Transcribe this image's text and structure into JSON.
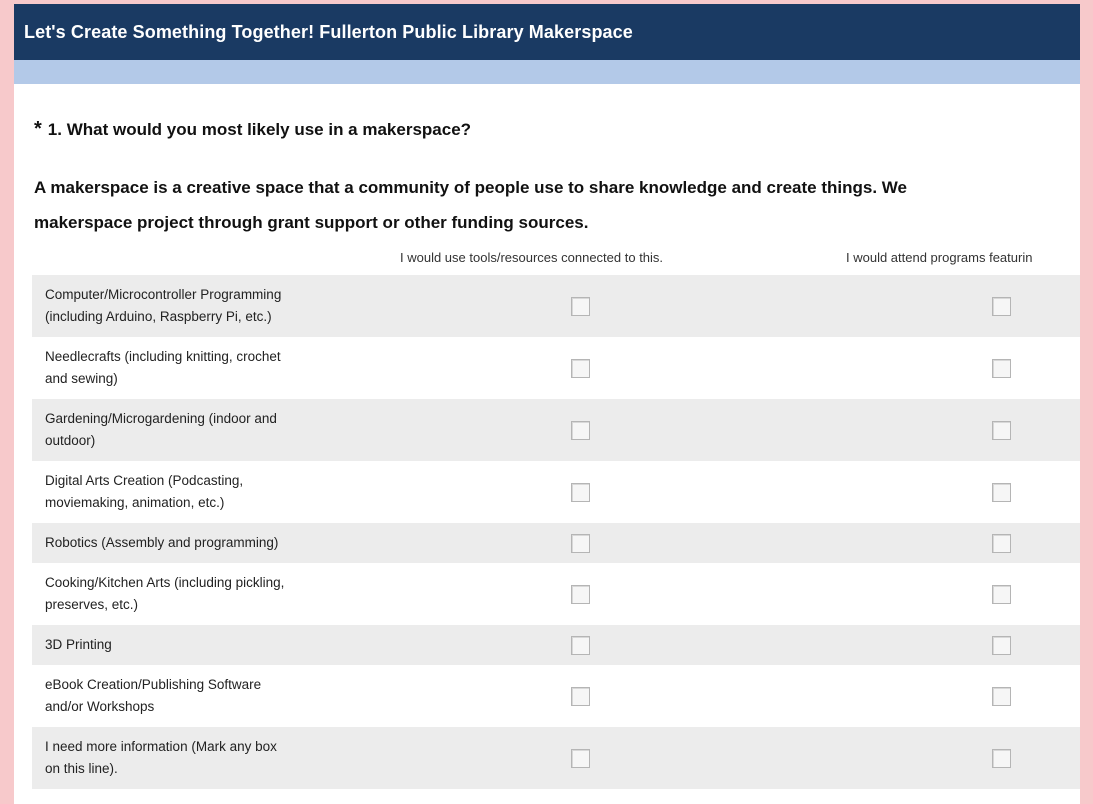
{
  "survey": {
    "title": "Let's Create Something Together! Fullerton Public Library Makerspace",
    "question": {
      "required_marker": "*",
      "text": "1. What would you most likely use in a makerspace?"
    },
    "description_lines": [
      "A makerspace is a creative space that a community of people use to share knowledge and create things. We",
      "makerspace project through grant support or other funding sources."
    ],
    "columns": [
      "I would use tools/resources connected to this.",
      "I would attend programs featurin"
    ],
    "rows": [
      {
        "label_lines": [
          "Computer/Microcontroller Programming",
          "(including Arduino, Raspberry Pi, etc.)"
        ],
        "use": false,
        "attend": false
      },
      {
        "label_lines": [
          "Needlecrafts (including knitting, crochet",
          "and sewing)"
        ],
        "use": false,
        "attend": false
      },
      {
        "label_lines": [
          "Gardening/Microgardening (indoor and",
          "outdoor)"
        ],
        "use": false,
        "attend": false
      },
      {
        "label_lines": [
          "Digital Arts Creation (Podcasting,",
          "moviemaking, animation, etc.)"
        ],
        "use": false,
        "attend": false
      },
      {
        "label_lines": [
          "Robotics (Assembly and programming)"
        ],
        "use": false,
        "attend": false
      },
      {
        "label_lines": [
          "Cooking/Kitchen Arts (including pickling,",
          "preserves, etc.)"
        ],
        "use": false,
        "attend": false
      },
      {
        "label_lines": [
          "3D Printing"
        ],
        "use": false,
        "attend": false
      },
      {
        "label_lines": [
          "eBook Creation/Publishing Software",
          "and/or Workshops"
        ],
        "use": false,
        "attend": false
      },
      {
        "label_lines": [
          "I need more information (Mark any box",
          "on this line)."
        ],
        "use": false,
        "attend": false
      }
    ]
  },
  "colors": {
    "page_background": "#f7c9cb",
    "header_background": "#1a3a63",
    "subbar": "#b3c9e8",
    "row_shade": "#ececec"
  }
}
